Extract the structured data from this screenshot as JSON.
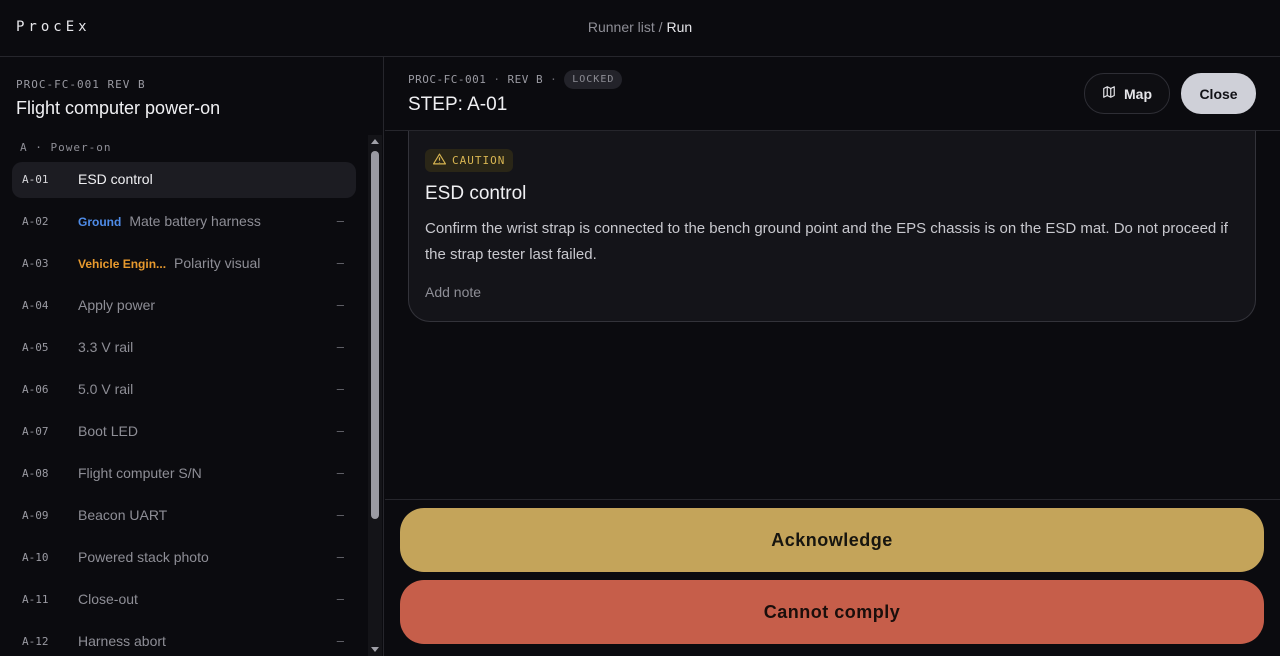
{
  "app": {
    "logo": "ProcEx"
  },
  "breadcrumb": {
    "parent": "Runner list",
    "separator": " / ",
    "current": "Run"
  },
  "sidebar": {
    "proc_code": "PROC-FC-001 REV B",
    "title": "Flight computer power-on",
    "section": "A · Power-on",
    "steps": [
      {
        "id": "A-01",
        "tag": "",
        "tag_kind": "",
        "label": "ESD control",
        "status": ""
      },
      {
        "id": "A-02",
        "tag": "Ground",
        "tag_kind": "ground",
        "label": "Mate battery harness",
        "status": "–"
      },
      {
        "id": "A-03",
        "tag": "Vehicle Engin...",
        "tag_kind": "veh",
        "label": "Polarity visual",
        "status": "–"
      },
      {
        "id": "A-04",
        "tag": "",
        "tag_kind": "",
        "label": "Apply power",
        "status": "–"
      },
      {
        "id": "A-05",
        "tag": "",
        "tag_kind": "",
        "label": "3.3 V rail",
        "status": "–"
      },
      {
        "id": "A-06",
        "tag": "",
        "tag_kind": "",
        "label": "5.0 V rail",
        "status": "–"
      },
      {
        "id": "A-07",
        "tag": "",
        "tag_kind": "",
        "label": "Boot LED",
        "status": "–"
      },
      {
        "id": "A-08",
        "tag": "",
        "tag_kind": "",
        "label": "Flight computer S/N",
        "status": "–"
      },
      {
        "id": "A-09",
        "tag": "",
        "tag_kind": "",
        "label": "Beacon UART",
        "status": "–"
      },
      {
        "id": "A-10",
        "tag": "",
        "tag_kind": "",
        "label": "Powered stack photo",
        "status": "–"
      },
      {
        "id": "A-11",
        "tag": "",
        "tag_kind": "",
        "label": "Close-out",
        "status": "–"
      },
      {
        "id": "A-12",
        "tag": "",
        "tag_kind": "",
        "label": "Harness abort",
        "status": "–"
      }
    ]
  },
  "step_header": {
    "proc": "PROC-FC-001",
    "rev": "REV B",
    "sep": "·",
    "locked": "LOCKED",
    "title": "STEP: A-01",
    "map_label": "Map",
    "close_label": "Close"
  },
  "card": {
    "badge": "CAUTION",
    "title": "ESD control",
    "body": "Confirm the wrist strap is connected to the bench ground point and the EPS chassis is on the ESD mat. Do not proceed if the strap tester last failed.",
    "add_note": "Add note"
  },
  "actions": {
    "acknowledge": "Acknowledge",
    "cannot_comply": "Cannot comply"
  },
  "colors": {
    "acknowledge": "#c4a45a",
    "cannot_comply": "#c65e4a",
    "ground_tag": "#4f8ce8",
    "vehicle_tag": "#e89a2e",
    "caution": "#d8b552"
  }
}
